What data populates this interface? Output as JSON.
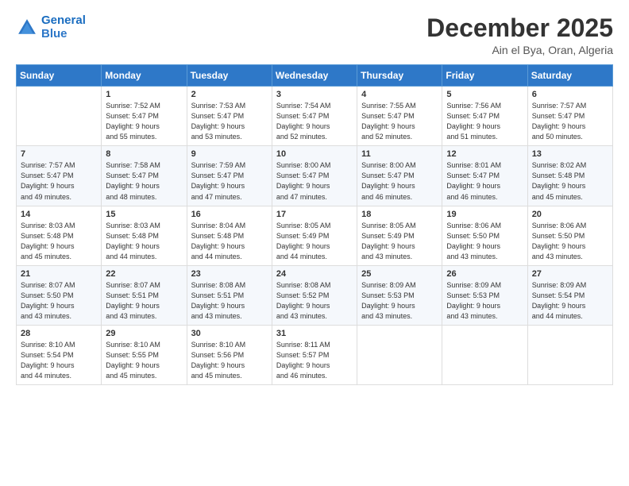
{
  "logo": {
    "line1": "General",
    "line2": "Blue"
  },
  "title": "December 2025",
  "subtitle": "Ain el Bya, Oran, Algeria",
  "weekdays": [
    "Sunday",
    "Monday",
    "Tuesday",
    "Wednesday",
    "Thursday",
    "Friday",
    "Saturday"
  ],
  "weeks": [
    [
      {
        "day": "",
        "detail": ""
      },
      {
        "day": "1",
        "detail": "Sunrise: 7:52 AM\nSunset: 5:47 PM\nDaylight: 9 hours\nand 55 minutes."
      },
      {
        "day": "2",
        "detail": "Sunrise: 7:53 AM\nSunset: 5:47 PM\nDaylight: 9 hours\nand 53 minutes."
      },
      {
        "day": "3",
        "detail": "Sunrise: 7:54 AM\nSunset: 5:47 PM\nDaylight: 9 hours\nand 52 minutes."
      },
      {
        "day": "4",
        "detail": "Sunrise: 7:55 AM\nSunset: 5:47 PM\nDaylight: 9 hours\nand 52 minutes."
      },
      {
        "day": "5",
        "detail": "Sunrise: 7:56 AM\nSunset: 5:47 PM\nDaylight: 9 hours\nand 51 minutes."
      },
      {
        "day": "6",
        "detail": "Sunrise: 7:57 AM\nSunset: 5:47 PM\nDaylight: 9 hours\nand 50 minutes."
      }
    ],
    [
      {
        "day": "7",
        "detail": "Sunrise: 7:57 AM\nSunset: 5:47 PM\nDaylight: 9 hours\nand 49 minutes."
      },
      {
        "day": "8",
        "detail": "Sunrise: 7:58 AM\nSunset: 5:47 PM\nDaylight: 9 hours\nand 48 minutes."
      },
      {
        "day": "9",
        "detail": "Sunrise: 7:59 AM\nSunset: 5:47 PM\nDaylight: 9 hours\nand 47 minutes."
      },
      {
        "day": "10",
        "detail": "Sunrise: 8:00 AM\nSunset: 5:47 PM\nDaylight: 9 hours\nand 47 minutes."
      },
      {
        "day": "11",
        "detail": "Sunrise: 8:00 AM\nSunset: 5:47 PM\nDaylight: 9 hours\nand 46 minutes."
      },
      {
        "day": "12",
        "detail": "Sunrise: 8:01 AM\nSunset: 5:47 PM\nDaylight: 9 hours\nand 46 minutes."
      },
      {
        "day": "13",
        "detail": "Sunrise: 8:02 AM\nSunset: 5:48 PM\nDaylight: 9 hours\nand 45 minutes."
      }
    ],
    [
      {
        "day": "14",
        "detail": "Sunrise: 8:03 AM\nSunset: 5:48 PM\nDaylight: 9 hours\nand 45 minutes."
      },
      {
        "day": "15",
        "detail": "Sunrise: 8:03 AM\nSunset: 5:48 PM\nDaylight: 9 hours\nand 44 minutes."
      },
      {
        "day": "16",
        "detail": "Sunrise: 8:04 AM\nSunset: 5:48 PM\nDaylight: 9 hours\nand 44 minutes."
      },
      {
        "day": "17",
        "detail": "Sunrise: 8:05 AM\nSunset: 5:49 PM\nDaylight: 9 hours\nand 44 minutes."
      },
      {
        "day": "18",
        "detail": "Sunrise: 8:05 AM\nSunset: 5:49 PM\nDaylight: 9 hours\nand 43 minutes."
      },
      {
        "day": "19",
        "detail": "Sunrise: 8:06 AM\nSunset: 5:50 PM\nDaylight: 9 hours\nand 43 minutes."
      },
      {
        "day": "20",
        "detail": "Sunrise: 8:06 AM\nSunset: 5:50 PM\nDaylight: 9 hours\nand 43 minutes."
      }
    ],
    [
      {
        "day": "21",
        "detail": "Sunrise: 8:07 AM\nSunset: 5:50 PM\nDaylight: 9 hours\nand 43 minutes."
      },
      {
        "day": "22",
        "detail": "Sunrise: 8:07 AM\nSunset: 5:51 PM\nDaylight: 9 hours\nand 43 minutes."
      },
      {
        "day": "23",
        "detail": "Sunrise: 8:08 AM\nSunset: 5:51 PM\nDaylight: 9 hours\nand 43 minutes."
      },
      {
        "day": "24",
        "detail": "Sunrise: 8:08 AM\nSunset: 5:52 PM\nDaylight: 9 hours\nand 43 minutes."
      },
      {
        "day": "25",
        "detail": "Sunrise: 8:09 AM\nSunset: 5:53 PM\nDaylight: 9 hours\nand 43 minutes."
      },
      {
        "day": "26",
        "detail": "Sunrise: 8:09 AM\nSunset: 5:53 PM\nDaylight: 9 hours\nand 43 minutes."
      },
      {
        "day": "27",
        "detail": "Sunrise: 8:09 AM\nSunset: 5:54 PM\nDaylight: 9 hours\nand 44 minutes."
      }
    ],
    [
      {
        "day": "28",
        "detail": "Sunrise: 8:10 AM\nSunset: 5:54 PM\nDaylight: 9 hours\nand 44 minutes."
      },
      {
        "day": "29",
        "detail": "Sunrise: 8:10 AM\nSunset: 5:55 PM\nDaylight: 9 hours\nand 45 minutes."
      },
      {
        "day": "30",
        "detail": "Sunrise: 8:10 AM\nSunset: 5:56 PM\nDaylight: 9 hours\nand 45 minutes."
      },
      {
        "day": "31",
        "detail": "Sunrise: 8:11 AM\nSunset: 5:57 PM\nDaylight: 9 hours\nand 46 minutes."
      },
      {
        "day": "",
        "detail": ""
      },
      {
        "day": "",
        "detail": ""
      },
      {
        "day": "",
        "detail": ""
      }
    ]
  ]
}
